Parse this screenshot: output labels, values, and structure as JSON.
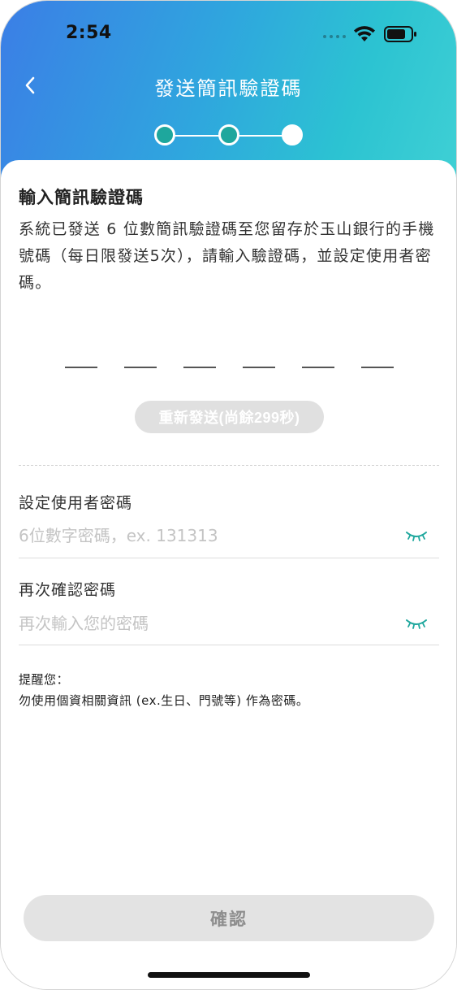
{
  "status_bar": {
    "time": "2:54"
  },
  "header": {
    "title": "發送簡訊驗證碼",
    "back_icon": "chevron-left-icon",
    "steps": [
      {
        "state": "done"
      },
      {
        "state": "done"
      },
      {
        "state": "current"
      }
    ],
    "gradient_colors": [
      "#3b7ee6",
      "#2cc3d2"
    ]
  },
  "verification": {
    "title": "輸入簡訊驗證碼",
    "description": "系統已發送 6 位數簡訊驗證碼至您留存於玉山銀行的手機號碼（每日限發送5次），請輸入驗證碼，並設定使用者密碼。",
    "otp_length": 6,
    "resend_label": "重新發送(尚餘299秒)"
  },
  "password": {
    "label": "設定使用者密碼",
    "placeholder": "6位數字密碼，ex. 131313",
    "value": ""
  },
  "confirm_password": {
    "label": "再次確認密碼",
    "placeholder": "再次輸入您的密碼",
    "value": ""
  },
  "reminder": {
    "title": "提醒您：",
    "text": "勿使用個資相關資訊 (ex.生日、門號等) 作為密碼。"
  },
  "footer": {
    "confirm_label": "確認"
  },
  "colors": {
    "accent": "#1ea79d",
    "disabled_button": "#e3e3e3"
  }
}
